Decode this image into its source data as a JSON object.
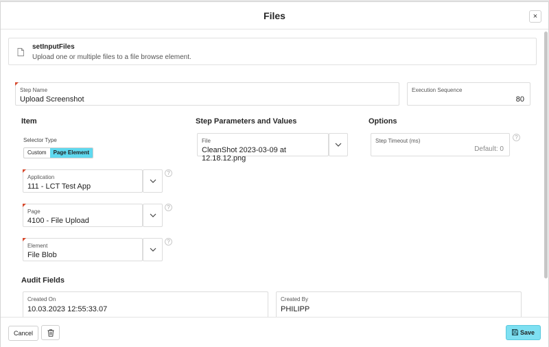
{
  "dialog": {
    "title": "Files",
    "close_label": "×"
  },
  "info": {
    "title": "setInputFiles",
    "description": "Upload one or multiple files to a file browse element."
  },
  "step_name": {
    "label": "Step Name",
    "value": "Upload Screenshot"
  },
  "execution_sequence": {
    "label": "Execution Sequence",
    "value": "80"
  },
  "item": {
    "title": "Item",
    "selector_type": {
      "label": "Selector Type",
      "options": [
        "Custom",
        "Page Element"
      ],
      "selected": "Page Element"
    },
    "application": {
      "label": "Application",
      "value": "111 - LCT Test App"
    },
    "page": {
      "label": "Page",
      "value": "4100 - File Upload"
    },
    "element": {
      "label": "Element",
      "value": "File Blob"
    }
  },
  "step_parameters": {
    "title": "Step Parameters and Values",
    "file": {
      "label": "File",
      "value": "CleanShot 2023-03-09 at 12.18.12.png"
    }
  },
  "options": {
    "title": "Options",
    "step_timeout": {
      "label": "Step Timeout (ms)",
      "placeholder": "Default: 0"
    }
  },
  "audit": {
    "title": "Audit Fields",
    "created_on": {
      "label": "Created On",
      "value": "10.03.2023 12:55:33.07"
    },
    "created_by": {
      "label": "Created By",
      "value": "PHILIPP"
    }
  },
  "footer": {
    "cancel_label": "Cancel",
    "save_label": "Save"
  },
  "help_glyph": "?",
  "icons": [
    "close-icon",
    "document-icon",
    "chevron-down-icon",
    "help-icon",
    "trash-icon",
    "save-icon"
  ],
  "colors": {
    "accent": "#7ee0f2",
    "segment_active": "#5fd9ef",
    "required_marker": "#d64a2e"
  }
}
